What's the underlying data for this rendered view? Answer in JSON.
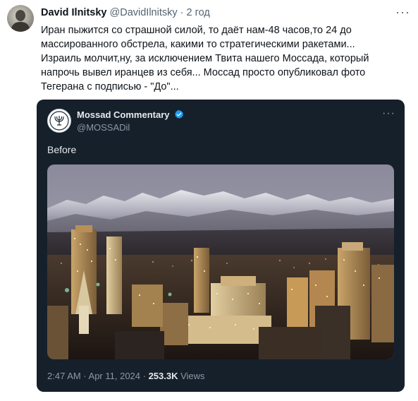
{
  "author": {
    "name": "David Ilnitsky",
    "handle": "@DavidIlnitsky",
    "separator": "·",
    "time": "2 год"
  },
  "more_icon": "more-horizontal-icon",
  "text_lines": [
    "Иран пыжится со страшной силой, то даёт нам-48 часов,то 24 до",
    "массированного обстрела, какими то стратегическими ракетами...",
    "Израиль молчит,ну, за исключением Твита нашего Моссада, который",
    "напрочь вывел иранцев из себя... Моссад просто опубликовал фото",
    "Тегерана с подписью - \"До\"..."
  ],
  "embedded": {
    "name": "Mossad Commentary",
    "verified_icon": "verified-badge-icon",
    "handle": "@MOSSADil",
    "text": "Before",
    "photo": "city-skyline-snowy-mountains-night",
    "meta_prefix": "2:47 AM · Apr 11, 2024 · ",
    "views_count": "253.3K",
    "views_label": " Views",
    "colors": {
      "background": "#15202b",
      "verified": "#1d9bf0"
    }
  }
}
